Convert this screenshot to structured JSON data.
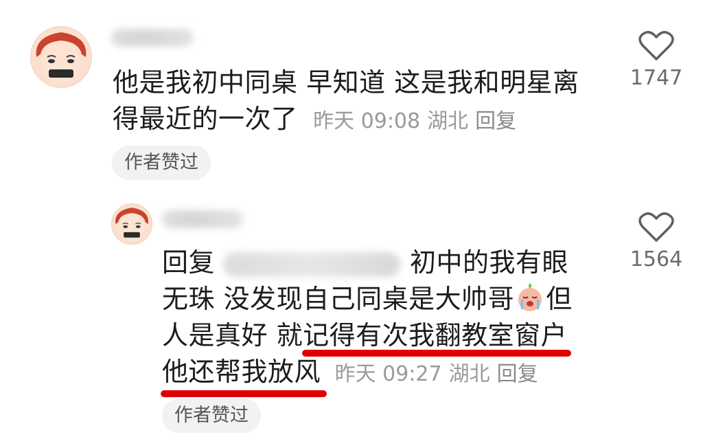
{
  "comments": [
    {
      "text_line1": "他是我初中同桌 早知道 这是我和明星离",
      "text_line2": "得最近的一次了",
      "time": "昨天 09:08",
      "location": "湖北",
      "reply_label": "回复",
      "badge": "作者赞过",
      "like_count": "1747"
    },
    {
      "reply_prefix": "回复",
      "text_line1_after_mention": "初中的我有眼",
      "text_line2_a": "无珠 没发现自己同桌是大帅哥",
      "text_line2_b": "但",
      "text_line3_a": "人是真好 就",
      "text_line3_b": "记得有次我翻教室窗户",
      "text_line4": "他还帮我放风",
      "time": "昨天 09:27",
      "location": "湖北",
      "reply_label": "回复",
      "badge": "作者赞过",
      "like_count": "1564"
    }
  ],
  "icons": {
    "like": "heart-outline-icon",
    "emoji": "crying-face-emoji-icon",
    "avatar": "cartoon-face-avatar"
  },
  "colors": {
    "highlight_underline": "#e00000",
    "meta_text": "#9a9a9a"
  }
}
